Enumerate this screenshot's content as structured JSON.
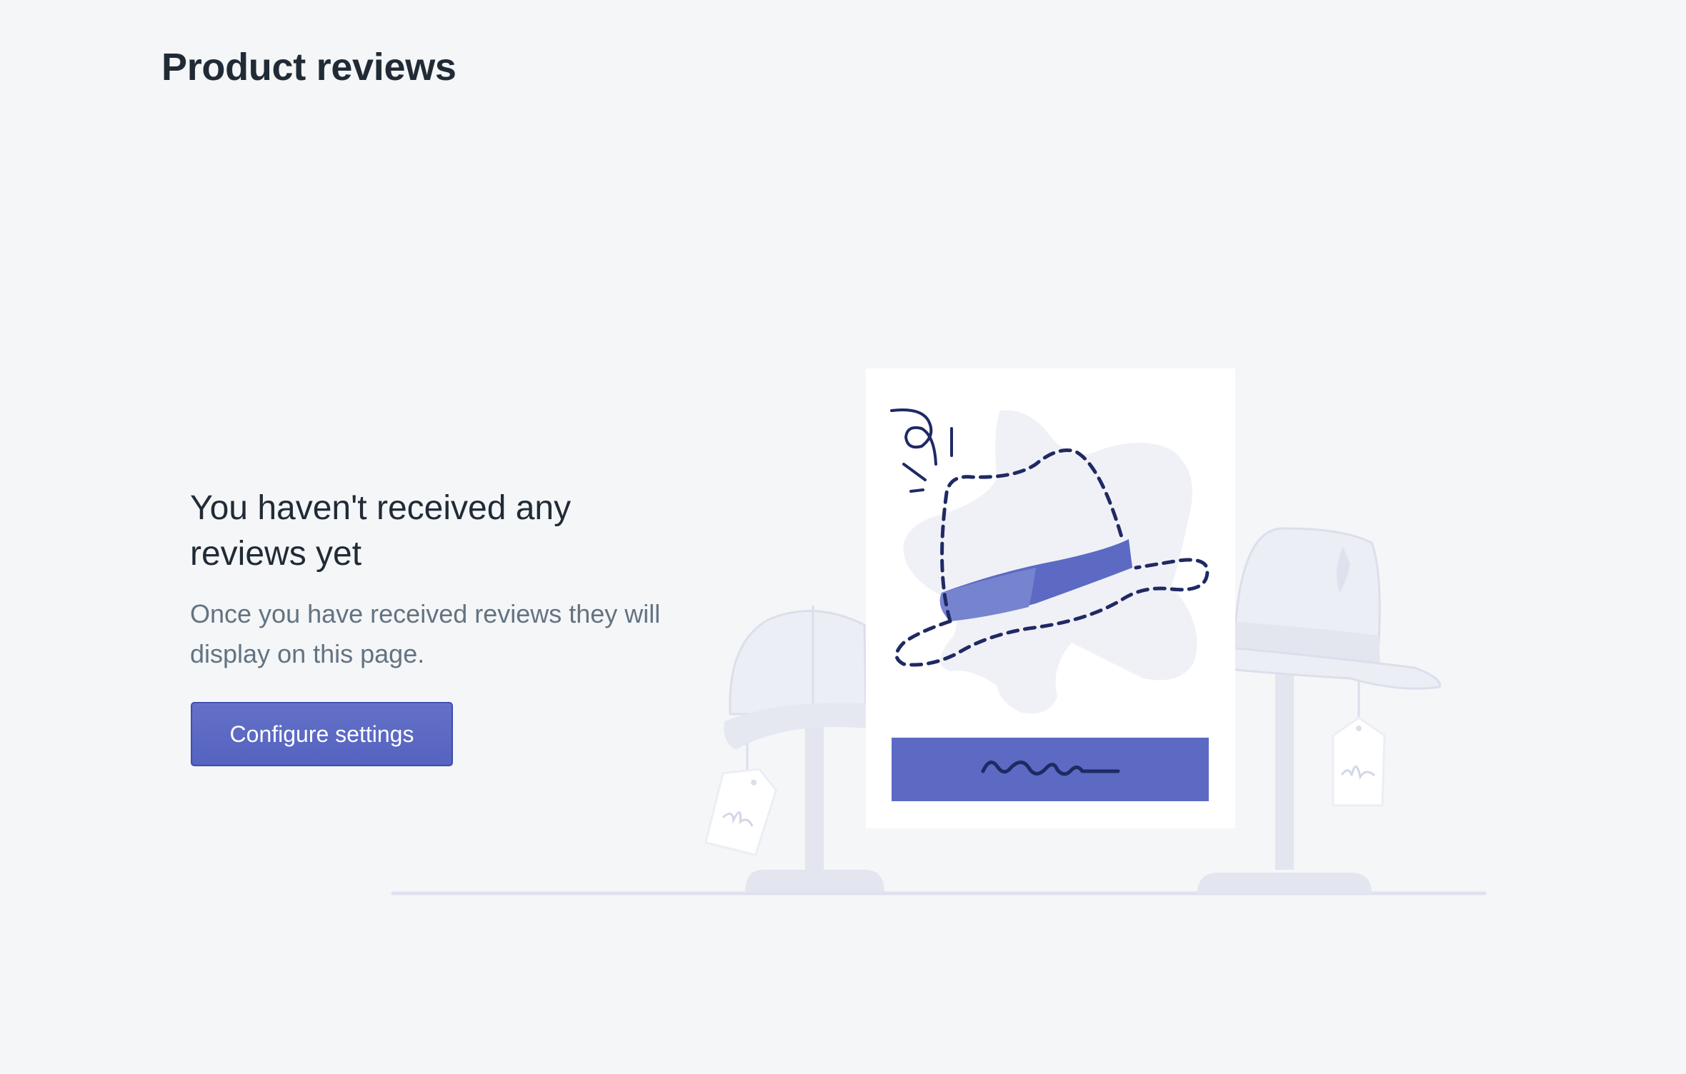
{
  "header": {
    "title": "Product reviews"
  },
  "empty_state": {
    "heading": "You haven't received any reviews yet",
    "description": "Once you have received reviews they will display on this page.",
    "action_label": "Configure settings",
    "illustration_icon": "hat-display-illustration"
  },
  "colors": {
    "background": "#f4f6f8",
    "primary_button": "#5c6ac4",
    "heading_text": "#212b36",
    "body_text": "#637381",
    "illustration_accent": "#5c6ac4",
    "illustration_ink": "#1f2a63"
  }
}
